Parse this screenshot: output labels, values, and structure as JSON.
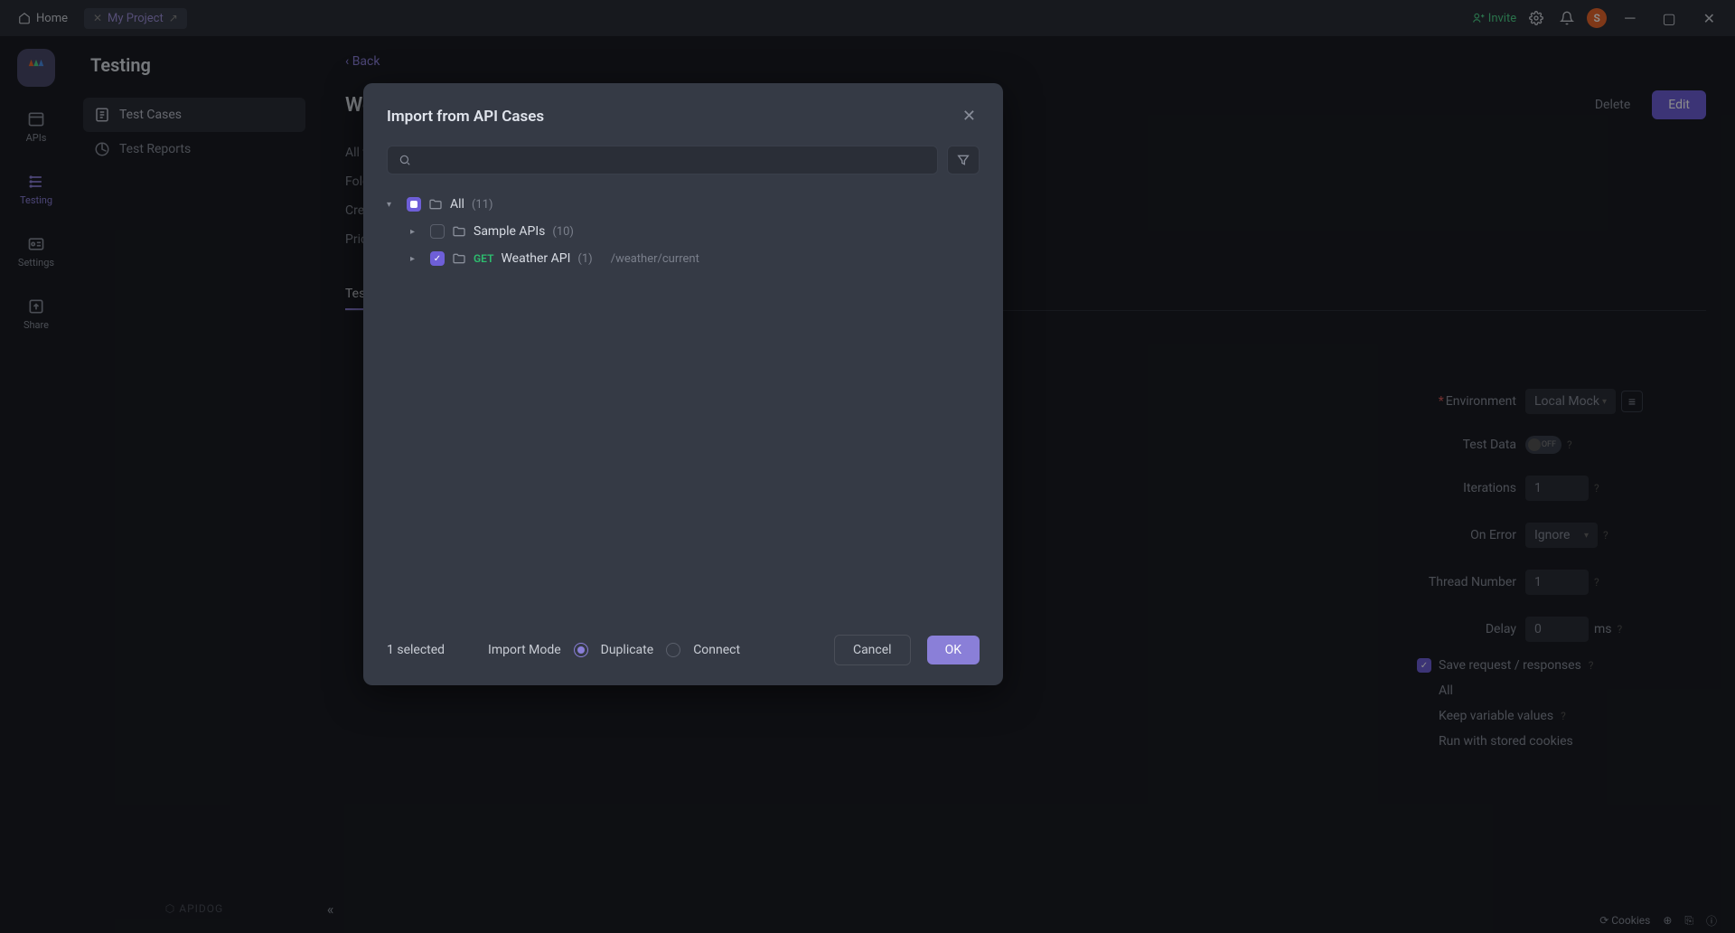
{
  "titlebar": {
    "home": "Home",
    "tab_name": "My Project",
    "invite": "Invite",
    "avatar_letter": "S"
  },
  "leftrail": {
    "items": [
      {
        "label": "APIs"
      },
      {
        "label": "Testing"
      },
      {
        "label": "Settings"
      },
      {
        "label": "Share"
      }
    ]
  },
  "sidebar": {
    "title": "Testing",
    "items": [
      {
        "label": "Test Cases"
      },
      {
        "label": "Test Reports"
      }
    ],
    "brand": "APIDOG"
  },
  "main": {
    "back": "Back",
    "page_title_partial": "Weat",
    "delete": "Delete",
    "edit": "Edit",
    "meta": {
      "alltags": "All t",
      "folder": "Fold",
      "created": "Cre",
      "priority": "Pric"
    },
    "tab": "Test"
  },
  "rightpanel": {
    "env_label": "Environment",
    "env_value": "Local Mock",
    "testdata_label": "Test Data",
    "testdata_state": "OFF",
    "iterations_label": "Iterations",
    "iterations_value": "1",
    "onerror_label": "On Error",
    "onerror_value": "Ignore",
    "thread_label": "Thread Number",
    "thread_value": "1",
    "delay_label": "Delay",
    "delay_value": "0",
    "delay_unit": "ms",
    "save_req": "Save request / responses",
    "all": "All",
    "keep_var": "Keep variable values",
    "run_cookies": "Run with stored cookies"
  },
  "bottom": {
    "cookies": "Cookies"
  },
  "modal": {
    "title": "Import from API Cases",
    "tree": {
      "root": {
        "label": "All",
        "count": "(11)"
      },
      "sample": {
        "label": "Sample APIs",
        "count": "(10)"
      },
      "weather": {
        "method": "GET",
        "label": "Weather API",
        "count": "(1)",
        "path": "/weather/current"
      }
    },
    "selected": "1 selected",
    "mode_label": "Import Mode",
    "mode_duplicate": "Duplicate",
    "mode_connect": "Connect",
    "cancel": "Cancel",
    "ok": "OK"
  }
}
